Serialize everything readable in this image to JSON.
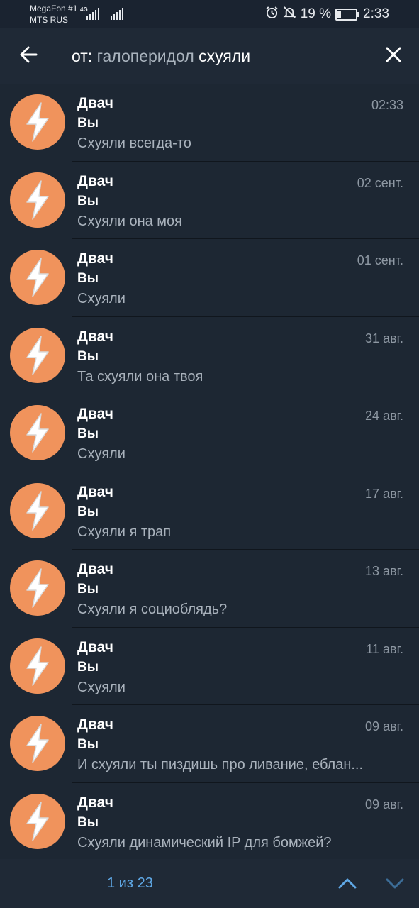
{
  "status_bar": {
    "carrier1": "MegaFon #1",
    "carrier2": "MTS RUS",
    "network": "4G",
    "battery": "19 %",
    "time": "2:33"
  },
  "header": {
    "prefix": "от:",
    "user": "галоперидол",
    "query": "схуяли"
  },
  "results": [
    {
      "name": "Двач",
      "sender": "Вы",
      "date": "02:33",
      "message": "Схуяли всегда-то"
    },
    {
      "name": "Двач",
      "sender": "Вы",
      "date": "02 сент.",
      "message": "Схуяли она моя"
    },
    {
      "name": "Двач",
      "sender": "Вы",
      "date": "01 сент.",
      "message": "Схуяли"
    },
    {
      "name": "Двач",
      "sender": "Вы",
      "date": "31 авг.",
      "message": "Та схуяли она твоя"
    },
    {
      "name": "Двач",
      "sender": "Вы",
      "date": "24 авг.",
      "message": "Схуяли"
    },
    {
      "name": "Двач",
      "sender": "Вы",
      "date": "17 авг.",
      "message": "Схуяли я трап"
    },
    {
      "name": "Двач",
      "sender": "Вы",
      "date": "13 авг.",
      "message": "Схуяли я социоблядь?"
    },
    {
      "name": "Двач",
      "sender": "Вы",
      "date": "11 авг.",
      "message": "Схуяли"
    },
    {
      "name": "Двач",
      "sender": "Вы",
      "date": "09 авг.",
      "message": "И схуяли ты пиздишь про ливание, еблан..."
    },
    {
      "name": "Двач",
      "sender": "Вы",
      "date": "09 авг.",
      "message": "Схуяли динамический IP для бомжей?"
    }
  ],
  "bottom_bar": {
    "counter": "1 из 23"
  },
  "colors": {
    "background": "#1d2733",
    "avatar": "#f0935c",
    "accent": "#5fa8e6"
  },
  "icons": {
    "back": "arrow-left-icon",
    "close": "close-icon",
    "up": "chevron-up-icon",
    "down": "chevron-down-icon",
    "avatar": "lightning-icon"
  }
}
